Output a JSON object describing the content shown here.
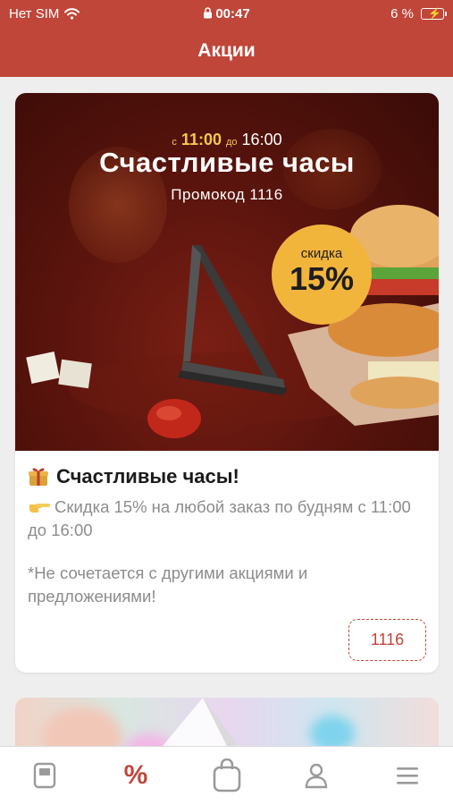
{
  "status_bar": {
    "carrier": "Нет SIM",
    "time": "00:47",
    "battery": "6 %"
  },
  "nav": {
    "title": "Акции"
  },
  "promo": {
    "banner": {
      "from_prefix": "с",
      "from_time": "11:00",
      "to_prefix": "до",
      "to_time": "16:00",
      "headline": "Счастливые часы",
      "promo_line": "Промокод  1116",
      "discount_label": "скидка",
      "discount_value": "15%"
    },
    "title": "Счастливые часы!",
    "description": "Скидка 15% на любой заказ по будням с 11:00 до 16:00",
    "note": "*Не сочетается с другими акциями и предложениями!",
    "code": "1116"
  },
  "tab_bar": {
    "items": [
      {
        "icon": "menu-card-icon",
        "active": false
      },
      {
        "icon": "percent-icon",
        "label": "%",
        "active": true
      },
      {
        "icon": "bag-icon",
        "active": false
      },
      {
        "icon": "profile-icon",
        "active": false
      },
      {
        "icon": "hamburger-icon",
        "active": false
      }
    ]
  },
  "colors": {
    "brand": "#c0463a",
    "discount": "#f2b53c",
    "muted_text": "#8c8c8c",
    "tab_inactive": "#9a9a9a"
  }
}
